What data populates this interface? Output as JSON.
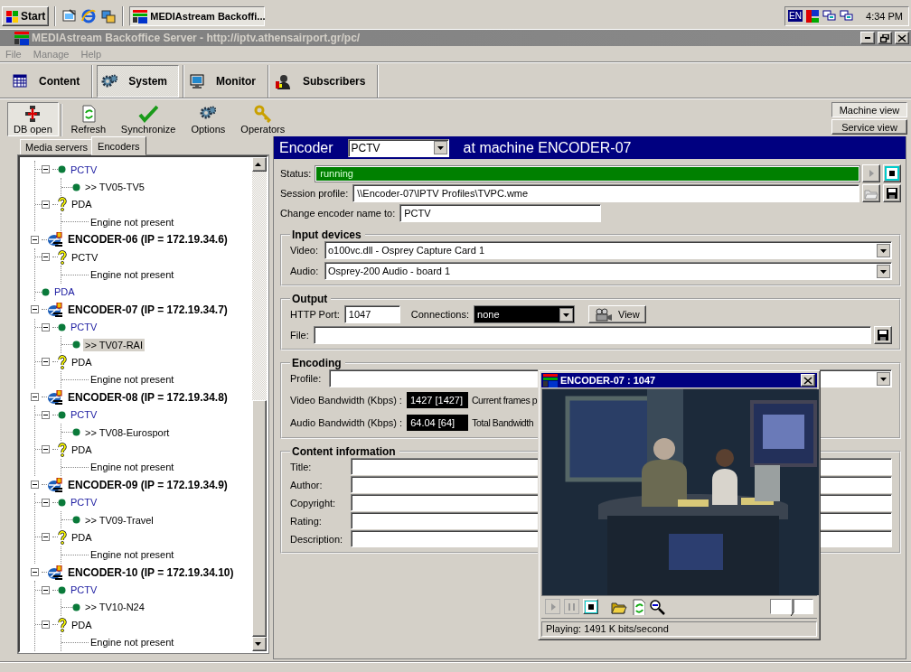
{
  "taskbar": {
    "start": "Start",
    "tasks": [
      {
        "label": "MEDIAstream Backoffi...",
        "selected": true
      }
    ],
    "tray": {
      "language": "EN",
      "clock": "4:34 PM"
    }
  },
  "window": {
    "title": "MEDIAstream Backoffice Server - http://iptv.athensairport.gr/pc/"
  },
  "menu": [
    {
      "label": "File",
      "disabled": true
    },
    {
      "label": "Manage",
      "disabled": true
    },
    {
      "label": "Help",
      "disabled": true
    }
  ],
  "sections": [
    {
      "label": "Content",
      "selected": false
    },
    {
      "label": "System",
      "selected": true
    },
    {
      "label": "Monitor",
      "selected": false
    },
    {
      "label": "Subscribers",
      "selected": false
    }
  ],
  "toolbar": [
    {
      "label": "DB open",
      "selected": true
    },
    {
      "label": "Refresh",
      "selected": false
    },
    {
      "label": "Synchronize",
      "selected": false
    },
    {
      "label": "Options",
      "selected": false
    },
    {
      "label": "Operators",
      "selected": false
    }
  ],
  "view_buttons": [
    {
      "label": "Machine view",
      "selected": true
    },
    {
      "label": "Service view",
      "selected": false
    }
  ],
  "left_tabs": [
    {
      "label": "Media servers",
      "selected": false
    },
    {
      "label": "Encoders",
      "selected": true
    }
  ],
  "tree": [
    {
      "kind": "encoder",
      "children": [
        {
          "kind": "engine",
          "label": "PCTV",
          "running": true,
          "expanded": true,
          "selected": false,
          "children": [
            {
              "kind": "stream",
              "label": ">> TV05-TV5",
              "selected": false
            }
          ]
        },
        {
          "kind": "engine",
          "label": "PDA",
          "running": false,
          "expanded": true,
          "selected": false,
          "children": [
            {
              "kind": "message",
              "label": "Engine not present",
              "selected": false
            }
          ]
        }
      ]
    },
    {
      "kind": "encoder",
      "label": "ENCODER-06 (IP = 172.19.34.6)",
      "expanded": true,
      "children": [
        {
          "kind": "engine",
          "label": "PCTV",
          "running": false,
          "expanded": true,
          "selected": false,
          "children": [
            {
              "kind": "message",
              "label": "Engine not present",
              "selected": false
            }
          ]
        },
        {
          "kind": "engine",
          "label": "PDA",
          "running": true,
          "selected": false
        }
      ]
    },
    {
      "kind": "encoder",
      "label": "ENCODER-07 (IP = 172.19.34.7)",
      "expanded": true,
      "children": [
        {
          "kind": "engine",
          "label": "PCTV",
          "running": true,
          "expanded": true,
          "selected": false,
          "children": [
            {
              "kind": "stream",
              "label": ">> TV07-RAI",
              "selected": true
            }
          ]
        },
        {
          "kind": "engine",
          "label": "PDA",
          "running": false,
          "expanded": true,
          "selected": false,
          "children": [
            {
              "kind": "message",
              "label": "Engine not present",
              "selected": false
            }
          ]
        }
      ]
    },
    {
      "kind": "encoder",
      "label": "ENCODER-08 (IP = 172.19.34.8)",
      "expanded": true,
      "children": [
        {
          "kind": "engine",
          "label": "PCTV",
          "running": true,
          "expanded": true,
          "selected": false,
          "children": [
            {
              "kind": "stream",
              "label": ">> TV08-Eurosport",
              "selected": false
            }
          ]
        },
        {
          "kind": "engine",
          "label": "PDA",
          "running": false,
          "expanded": true,
          "selected": false,
          "children": [
            {
              "kind": "message",
              "label": "Engine not present",
              "selected": false
            }
          ]
        }
      ]
    },
    {
      "kind": "encoder",
      "label": "ENCODER-09 (IP = 172.19.34.9)",
      "expanded": true,
      "children": [
        {
          "kind": "engine",
          "label": "PCTV",
          "running": true,
          "expanded": true,
          "selected": false,
          "children": [
            {
              "kind": "stream",
              "label": ">> TV09-Travel",
              "selected": false
            }
          ]
        },
        {
          "kind": "engine",
          "label": "PDA",
          "running": false,
          "expanded": true,
          "selected": false,
          "children": [
            {
              "kind": "message",
              "label": "Engine not present",
              "selected": false
            }
          ]
        }
      ]
    },
    {
      "kind": "encoder",
      "label": "ENCODER-10 (IP = 172.19.34.10)",
      "expanded": true,
      "children": [
        {
          "kind": "engine",
          "label": "PCTV",
          "running": true,
          "expanded": true,
          "selected": false,
          "children": [
            {
              "kind": "stream",
              "label": ">> TV10-N24",
              "selected": false
            }
          ]
        },
        {
          "kind": "engine",
          "label": "PDA",
          "running": false,
          "expanded": true,
          "selected": false,
          "children": [
            {
              "kind": "message",
              "label": "Engine not present",
              "selected": false
            }
          ]
        }
      ]
    }
  ],
  "encoder": {
    "heading": "Encoder",
    "name": "PCTV",
    "machine": "at machine ENCODER-07",
    "status_label": "Status:",
    "status": "running",
    "session_label": "Session profile:",
    "session_profile": "\\\\Encoder-07\\IPTV Profiles\\TVPC.wme",
    "rename_label": "Change encoder name to:",
    "rename_value": "PCTV"
  },
  "input_devices": {
    "title": "Input devices",
    "rows": [
      {
        "label": "Video:",
        "value": "o100vc.dll - Osprey Capture Card 1"
      },
      {
        "label": "Audio:",
        "value": "Osprey-200 Audio - board 1"
      }
    ]
  },
  "output": {
    "title": "Output",
    "port_label": "HTTP Port:",
    "port": "1047",
    "connections_label": "Connections:",
    "connections": "none",
    "view_button": "View",
    "file_label": "File:"
  },
  "encoding": {
    "title": "Encoding",
    "profile_label": "Profile:",
    "video_label": "Video Bandwidth (Kbps) :",
    "video_value": "1427 [1427]",
    "frames_label": "Current frames p",
    "audio_label": "Audio Bandwidth (Kbps) :",
    "audio_value": "64.04 [64]",
    "total_label": "Total Bandwidth"
  },
  "content_information": {
    "title": "Content information",
    "fields": [
      "Title:",
      "Author:",
      "Copyright:",
      "Rating:",
      "Description:"
    ]
  },
  "player": {
    "title": "ENCODER-07 : 1047",
    "volume": {
      "level": 0.55
    },
    "status": "Playing: 1491 K bits/second"
  }
}
